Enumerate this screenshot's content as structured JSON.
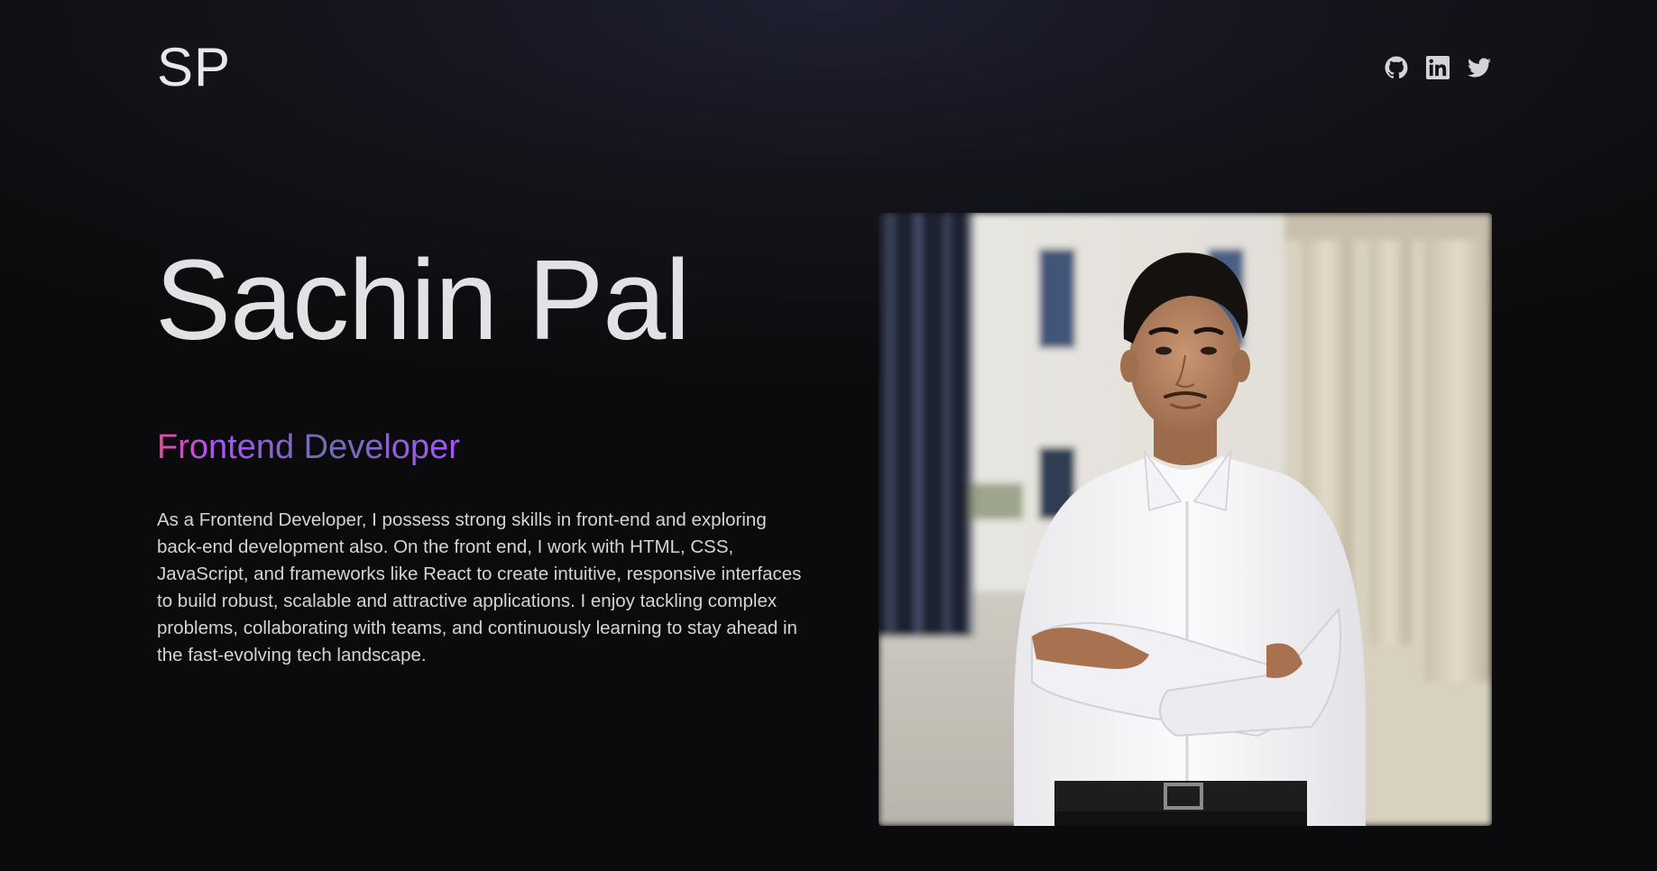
{
  "header": {
    "logo": "SP",
    "socials": [
      {
        "icon": "github-icon",
        "label": "GitHub"
      },
      {
        "icon": "linkedin-icon",
        "label": "LinkedIn"
      },
      {
        "icon": "twitter-icon",
        "label": "Twitter"
      }
    ]
  },
  "hero": {
    "name": "Sachin Pal",
    "role": "Frontend Developer",
    "bio": "As a Frontend Developer, I possess strong skills in front-end and exploring back-end development also. On the front end, I work with HTML, CSS, JavaScript, and frameworks like React to create intuitive, responsive interfaces to build robust, scalable and attractive applications. I enjoy tackling complex problems, collaborating with teams, and continuously learning to stay ahead in the fast-evolving tech landscape."
  },
  "colors": {
    "background": "#0b0b0d",
    "text": "#e4e4e7",
    "gradient_start": "#ec4899",
    "gradient_mid": "#6d6fae",
    "gradient_end": "#a855f7"
  }
}
